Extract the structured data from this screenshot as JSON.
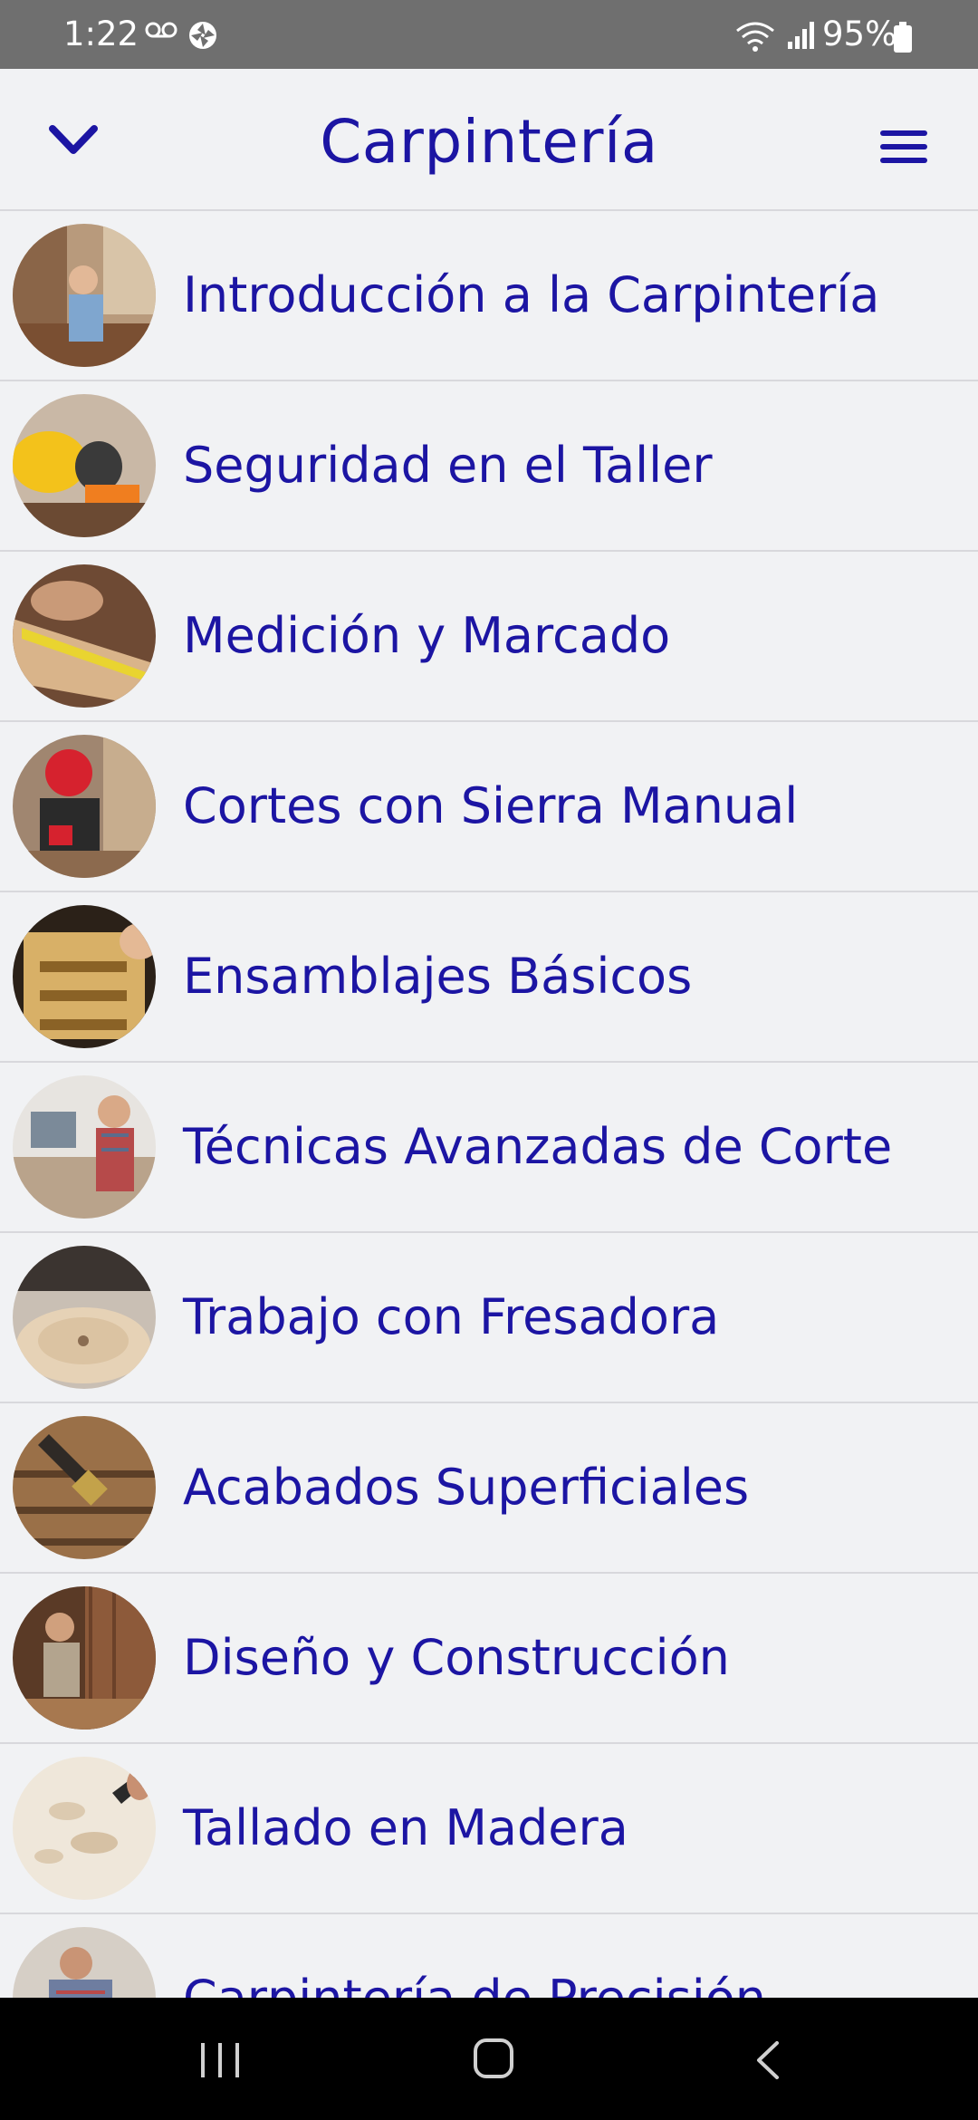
{
  "status_bar": {
    "time": "1:22",
    "battery": "95%",
    "icons": [
      "voicemail-icon",
      "app-notification-icon",
      "wifi-icon",
      "signal-icon",
      "battery-icon"
    ]
  },
  "header": {
    "title": "Carpintería",
    "left_icon": "chevron-down-icon",
    "right_icon": "hamburger-menu-icon",
    "accent_color": "#1c15a3"
  },
  "lessons": [
    {
      "label": "Introducción a la Carpintería"
    },
    {
      "label": "Seguridad en el Taller"
    },
    {
      "label": "Medición y Marcado"
    },
    {
      "label": "Cortes con Sierra Manual"
    },
    {
      "label": "Ensamblajes Básicos"
    },
    {
      "label": "Técnicas Avanzadas de Corte"
    },
    {
      "label": "Trabajo con Fresadora"
    },
    {
      "label": "Acabados Superficiales"
    },
    {
      "label": "Diseño y Construcción"
    },
    {
      "label": "Tallado en Madera"
    },
    {
      "label": "Carpintería de Precisión"
    }
  ],
  "nav_bar": {
    "icons": [
      "recent-apps-icon",
      "home-icon",
      "back-icon"
    ]
  }
}
